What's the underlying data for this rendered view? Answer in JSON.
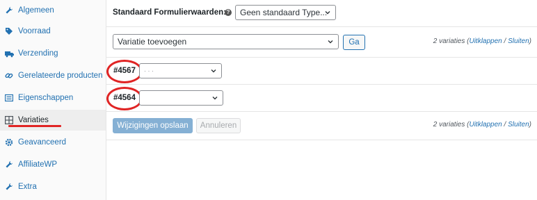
{
  "sidebar": {
    "items": [
      {
        "label": "Algemeen",
        "icon": "wrench-icon"
      },
      {
        "label": "Voorraad",
        "icon": "tag-icon"
      },
      {
        "label": "Verzending",
        "icon": "truck-icon"
      },
      {
        "label": "Gerelateerde producten",
        "icon": "link-icon"
      },
      {
        "label": "Eigenschappen",
        "icon": "list-icon"
      },
      {
        "label": "Variaties",
        "icon": "grid-icon"
      },
      {
        "label": "Geavanceerd",
        "icon": "gear-icon"
      },
      {
        "label": "AffiliateWP",
        "icon": "wrench-icon"
      },
      {
        "label": "Extra",
        "icon": "wrench-icon"
      }
    ],
    "active": "Variaties"
  },
  "defaults": {
    "label": "Standaard Formulierwaarden:",
    "help": "?",
    "select_value": "Geen standaard Type..."
  },
  "add_variation": {
    "select_value": "Variatie toevoegen",
    "go_label": "Ga"
  },
  "variation_count": {
    "text": "2 variaties (",
    "expand": "Uitklappen",
    "sep": " / ",
    "close": "Sluiten",
    "end": ")"
  },
  "variations": [
    {
      "id": "#4567",
      "select_value": "· · ·"
    },
    {
      "id": "#4564",
      "select_value": ""
    }
  ],
  "actions": {
    "save_label": "Wijzigingen opslaan",
    "cancel_label": "Annuleren"
  },
  "colors": {
    "link": "#2271b1",
    "annotation": "#e02424"
  }
}
